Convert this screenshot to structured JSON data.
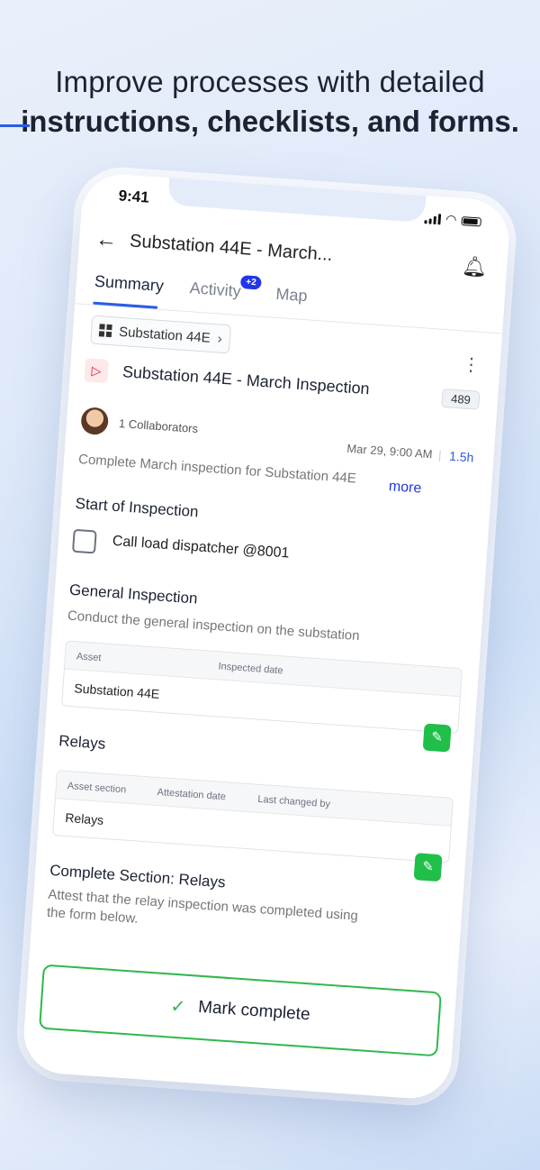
{
  "marketing": {
    "headline_line1": "Improve processes with detailed",
    "headline_line2": "instructions, checklists, and forms."
  },
  "status_bar": {
    "time": "9:41"
  },
  "header": {
    "back_icon": "arrow-left-icon",
    "title": "Substation 44E - March...",
    "bell_icon": "bell-icon"
  },
  "tabs": [
    {
      "label": "Summary",
      "active": true
    },
    {
      "label": "Activity",
      "badge": "+2"
    },
    {
      "label": "Map"
    }
  ],
  "asset_chip": {
    "label": "Substation 44E"
  },
  "task": {
    "title": "Substation 44E - March Inspection",
    "count": "489",
    "collaborators": "1 Collaborators",
    "date": "Mar 29, 9:00 AM",
    "separator": "|",
    "duration": "1.5h",
    "description": "Complete March inspection for Substation 44E",
    "more_label": "more"
  },
  "sections": {
    "start": {
      "heading": "Start of Inspection",
      "checkbox_label": "Call load dispatcher @8001"
    },
    "general": {
      "heading": "General Inspection",
      "subtitle": "Conduct the general inspection on the substation",
      "columns": [
        "Asset",
        "Inspected date"
      ],
      "row": [
        "Substation 44E"
      ]
    },
    "relays": {
      "heading": "Relays",
      "columns": [
        "Asset section",
        "Attestation date",
        "Last changed by"
      ],
      "row": [
        "Relays"
      ]
    },
    "complete_relays": {
      "heading": "Complete Section: Relays",
      "subtitle_line1": "Attest that the relay inspection was completed using",
      "subtitle_line2": "the form below."
    }
  },
  "footer": {
    "mark_complete_label": "Mark complete"
  },
  "colors": {
    "accent": "#2a5be8",
    "badge": "#2236e8",
    "success": "#2fb84c",
    "edit_button": "#1fbf4a"
  }
}
